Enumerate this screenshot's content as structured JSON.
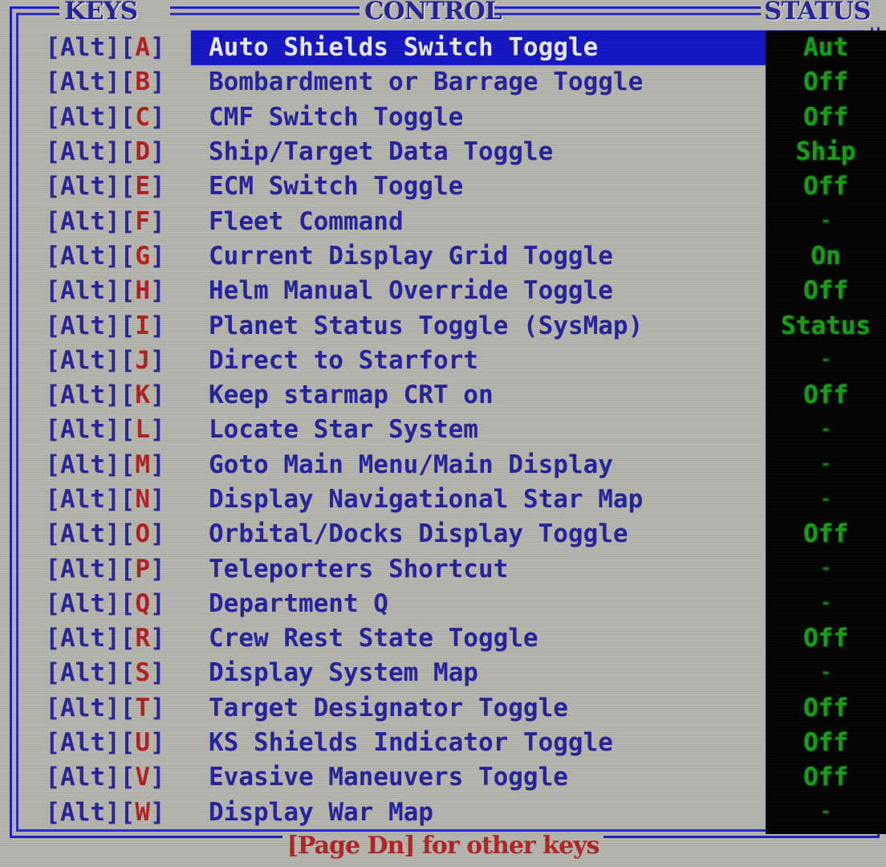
{
  "screen": {
    "background_color": "#b5b5ad",
    "border_color": "#2a2ad4",
    "highlight_color": "#1414c4",
    "status_text_color": "#12a012",
    "status_bg_color": "#000000",
    "key_letter_color": "#b02020",
    "label_color": "#22229c",
    "footer_color": "#b02424"
  },
  "columns": {
    "keys": "KEYS",
    "control": "CONTROL",
    "status": "STATUS"
  },
  "footer": {
    "hint": "[Page Dn] for other keys"
  },
  "rows": [
    {
      "mod": "[Alt]",
      "key": "A",
      "control": "Auto Shields Switch Toggle",
      "status": "Aut",
      "selected": true
    },
    {
      "mod": "[Alt]",
      "key": "B",
      "control": "Bombardment or Barrage Toggle",
      "status": "Off",
      "selected": false
    },
    {
      "mod": "[Alt]",
      "key": "C",
      "control": "CMF Switch Toggle",
      "status": "Off",
      "selected": false
    },
    {
      "mod": "[Alt]",
      "key": "D",
      "control": "Ship/Target Data Toggle",
      "status": "Ship",
      "selected": false
    },
    {
      "mod": "[Alt]",
      "key": "E",
      "control": "ECM Switch Toggle",
      "status": "Off",
      "selected": false
    },
    {
      "mod": "[Alt]",
      "key": "F",
      "control": "Fleet Command",
      "status": "-",
      "selected": false
    },
    {
      "mod": "[Alt]",
      "key": "G",
      "control": "Current Display Grid Toggle",
      "status": "On",
      "selected": false
    },
    {
      "mod": "[Alt]",
      "key": "H",
      "control": "Helm Manual Override Toggle",
      "status": "Off",
      "selected": false
    },
    {
      "mod": "[Alt]",
      "key": "I",
      "control": "Planet Status Toggle (SysMap)",
      "status": "Status",
      "selected": false
    },
    {
      "mod": "[Alt]",
      "key": "J",
      "control": "Direct to Starfort",
      "status": "-",
      "selected": false
    },
    {
      "mod": "[Alt]",
      "key": "K",
      "control": "Keep starmap CRT on",
      "status": "Off",
      "selected": false
    },
    {
      "mod": "[Alt]",
      "key": "L",
      "control": "Locate Star System",
      "status": "-",
      "selected": false
    },
    {
      "mod": "[Alt]",
      "key": "M",
      "control": "Goto Main Menu/Main Display",
      "status": "-",
      "selected": false
    },
    {
      "mod": "[Alt]",
      "key": "N",
      "control": "Display Navigational Star Map",
      "status": "-",
      "selected": false
    },
    {
      "mod": "[Alt]",
      "key": "O",
      "control": "Orbital/Docks Display Toggle",
      "status": "Off",
      "selected": false
    },
    {
      "mod": "[Alt]",
      "key": "P",
      "control": "Teleporters Shortcut",
      "status": "-",
      "selected": false
    },
    {
      "mod": "[Alt]",
      "key": "Q",
      "control": "Department Q",
      "status": "-",
      "selected": false
    },
    {
      "mod": "[Alt]",
      "key": "R",
      "control": "Crew Rest State Toggle",
      "status": "Off",
      "selected": false
    },
    {
      "mod": "[Alt]",
      "key": "S",
      "control": "Display System Map",
      "status": "-",
      "selected": false
    },
    {
      "mod": "[Alt]",
      "key": "T",
      "control": "Target Designator Toggle",
      "status": "Off",
      "selected": false
    },
    {
      "mod": "[Alt]",
      "key": "U",
      "control": "KS Shields Indicator Toggle",
      "status": "Off",
      "selected": false
    },
    {
      "mod": "[Alt]",
      "key": "V",
      "control": "Evasive Maneuvers Toggle",
      "status": "Off",
      "selected": false
    },
    {
      "mod": "[Alt]",
      "key": "W",
      "control": "Display War Map",
      "status": "-",
      "selected": false
    }
  ]
}
